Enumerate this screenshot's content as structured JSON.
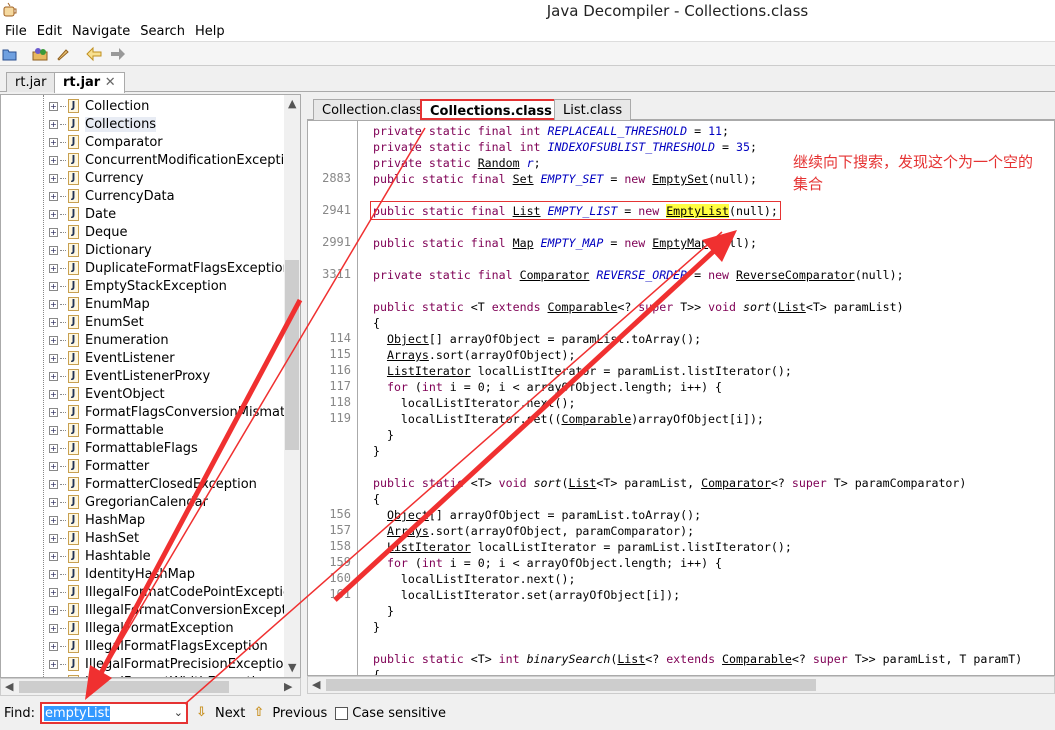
{
  "window": {
    "title": "Java Decompiler - Collections.class"
  },
  "menu": [
    "File",
    "Edit",
    "Navigate",
    "Search",
    "Help"
  ],
  "toolbar": [
    "open-folder-icon",
    "open-type-icon",
    "search-icon",
    "back-arrow-icon",
    "forward-arrow-icon"
  ],
  "jar_tabs": [
    {
      "label": "rt.jar",
      "active": false
    },
    {
      "label": "rt.jar",
      "active": true
    }
  ],
  "tree": {
    "items": [
      "Collection",
      "Collections",
      "Comparator",
      "ConcurrentModificationException",
      "Currency",
      "CurrencyData",
      "Date",
      "Deque",
      "Dictionary",
      "DuplicateFormatFlagsException",
      "EmptyStackException",
      "EnumMap",
      "EnumSet",
      "Enumeration",
      "EventListener",
      "EventListenerProxy",
      "EventObject",
      "FormatFlagsConversionMismatchE",
      "Formattable",
      "FormattableFlags",
      "Formatter",
      "FormatterClosedException",
      "GregorianCalendar",
      "HashMap",
      "HashSet",
      "Hashtable",
      "IdentityHashMap",
      "IllegalFormatCodePointException",
      "IllegalFormatConversionException",
      "IllegalFormatException",
      "IllegalFormatFlagsException",
      "IllegalFormatPrecisionException",
      "IllegalFormatWidthException"
    ],
    "selected": "Collections"
  },
  "file_tabs": [
    {
      "label": "Collection.class",
      "active": false
    },
    {
      "label": "Collections.class",
      "active": true
    },
    {
      "label": "List.class",
      "active": false
    }
  ],
  "code": [
    {
      "ln": "",
      "t": [
        [
          "k",
          "private static final int "
        ],
        [
          "i",
          "REPLACEALL_THRESHOLD"
        ],
        [
          "p",
          " = "
        ],
        [
          "n",
          "11"
        ],
        [
          "p",
          ";"
        ]
      ]
    },
    {
      "ln": "",
      "t": [
        [
          "k",
          "private static final int "
        ],
        [
          "i",
          "INDEXOFSUBLIST_THRESHOLD"
        ],
        [
          "p",
          " = "
        ],
        [
          "n",
          "35"
        ],
        [
          "p",
          ";"
        ]
      ]
    },
    {
      "ln": "",
      "t": [
        [
          "k",
          "private static "
        ],
        [
          "u",
          "Random"
        ],
        [
          "p",
          " "
        ],
        [
          "i",
          "r"
        ],
        [
          "p",
          ";"
        ]
      ]
    },
    {
      "ln": "2883",
      "t": [
        [
          "k",
          "public static final "
        ],
        [
          "u",
          "Set"
        ],
        [
          "p",
          " "
        ],
        [
          "i",
          "EMPTY_SET"
        ],
        [
          "p",
          " = "
        ],
        [
          "k",
          "new "
        ],
        [
          "u",
          "EmptySet"
        ],
        [
          "p",
          "(null);"
        ]
      ]
    },
    {
      "ln": "",
      "t": []
    },
    {
      "ln": "2941",
      "t": [
        [
          "k",
          "public static final "
        ],
        [
          "u",
          "List"
        ],
        [
          "p",
          " "
        ],
        [
          "i",
          "EMPTY_LIST"
        ],
        [
          "p",
          " = "
        ],
        [
          "k",
          "new "
        ],
        [
          "h",
          "EmptyList"
        ],
        [
          "p",
          "(null);"
        ]
      ]
    },
    {
      "ln": "",
      "t": []
    },
    {
      "ln": "2991",
      "t": [
        [
          "k",
          "public static final "
        ],
        [
          "u",
          "Map"
        ],
        [
          "p",
          " "
        ],
        [
          "i",
          "EMPTY_MAP"
        ],
        [
          "p",
          " = "
        ],
        [
          "k",
          "new "
        ],
        [
          "u",
          "EmptyMap"
        ],
        [
          "p",
          "(null);"
        ]
      ]
    },
    {
      "ln": "",
      "t": []
    },
    {
      "ln": "3311",
      "t": [
        [
          "k",
          "private static final "
        ],
        [
          "u",
          "Comparator"
        ],
        [
          "p",
          " "
        ],
        [
          "i",
          "REVERSE_ORDER"
        ],
        [
          "p",
          " = "
        ],
        [
          "k",
          "new "
        ],
        [
          "u",
          "ReverseComparator"
        ],
        [
          "p",
          "(null);"
        ]
      ]
    },
    {
      "ln": "",
      "t": []
    },
    {
      "ln": "",
      "t": [
        [
          "k",
          "public static "
        ],
        [
          "p",
          "<T "
        ],
        [
          "k",
          "extends "
        ],
        [
          "u",
          "Comparable"
        ],
        [
          "p",
          "<? "
        ],
        [
          "k",
          "super "
        ],
        [
          "p",
          "T>> "
        ],
        [
          "k",
          "void "
        ],
        [
          "m",
          "sort"
        ],
        [
          "p",
          "("
        ],
        [
          "u",
          "List"
        ],
        [
          "p",
          "<T> paramList)"
        ]
      ]
    },
    {
      "ln": "",
      "t": [
        [
          "p",
          "{"
        ]
      ]
    },
    {
      "ln": "114",
      "t": [
        [
          "p",
          "  "
        ],
        [
          "u",
          "Object"
        ],
        [
          "p",
          "[] arrayOfObject = paramList.toArray();"
        ]
      ]
    },
    {
      "ln": "115",
      "t": [
        [
          "p",
          "  "
        ],
        [
          "u",
          "Arrays"
        ],
        [
          "p",
          ".sort(arrayOfObject);"
        ]
      ]
    },
    {
      "ln": "116",
      "t": [
        [
          "p",
          "  "
        ],
        [
          "u",
          "ListIterator"
        ],
        [
          "p",
          " localListIterator = paramList.listIterator();"
        ]
      ]
    },
    {
      "ln": "117",
      "t": [
        [
          "p",
          "  "
        ],
        [
          "k",
          "for "
        ],
        [
          "p",
          "("
        ],
        [
          "k",
          "int "
        ],
        [
          "p",
          "i = 0; i < arrayOfObject.length; i++) {"
        ]
      ]
    },
    {
      "ln": "118",
      "t": [
        [
          "p",
          "    localListIterator.next();"
        ]
      ]
    },
    {
      "ln": "119",
      "t": [
        [
          "p",
          "    localListIterator.set(("
        ],
        [
          "u",
          "Comparable"
        ],
        [
          "p",
          ")arrayOfObject[i]);"
        ]
      ]
    },
    {
      "ln": "",
      "t": [
        [
          "p",
          "  }"
        ]
      ]
    },
    {
      "ln": "",
      "t": [
        [
          "p",
          "}"
        ]
      ]
    },
    {
      "ln": "",
      "t": []
    },
    {
      "ln": "",
      "t": [
        [
          "k",
          "public static "
        ],
        [
          "p",
          "<T> "
        ],
        [
          "k",
          "void "
        ],
        [
          "m",
          "sort"
        ],
        [
          "p",
          "("
        ],
        [
          "u",
          "List"
        ],
        [
          "p",
          "<T> paramList, "
        ],
        [
          "u",
          "Comparator"
        ],
        [
          "p",
          "<? "
        ],
        [
          "k",
          "super "
        ],
        [
          "p",
          "T> paramComparator)"
        ]
      ]
    },
    {
      "ln": "",
      "t": [
        [
          "p",
          "{"
        ]
      ]
    },
    {
      "ln": "156",
      "t": [
        [
          "p",
          "  "
        ],
        [
          "u",
          "Object"
        ],
        [
          "p",
          "[] arrayOfObject = paramList.toArray();"
        ]
      ]
    },
    {
      "ln": "157",
      "t": [
        [
          "p",
          "  "
        ],
        [
          "u",
          "Arrays"
        ],
        [
          "p",
          ".sort(arrayOfObject, paramComparator);"
        ]
      ]
    },
    {
      "ln": "158",
      "t": [
        [
          "p",
          "  "
        ],
        [
          "u",
          "ListIterator"
        ],
        [
          "p",
          " localListIterator = paramList.listIterator();"
        ]
      ]
    },
    {
      "ln": "159",
      "t": [
        [
          "p",
          "  "
        ],
        [
          "k",
          "for "
        ],
        [
          "p",
          "("
        ],
        [
          "k",
          "int "
        ],
        [
          "p",
          "i = 0; i < arrayOfObject.length; i++) {"
        ]
      ]
    },
    {
      "ln": "160",
      "t": [
        [
          "p",
          "    localListIterator.next();"
        ]
      ]
    },
    {
      "ln": "161",
      "t": [
        [
          "p",
          "    localListIterator.set(arrayOfObject[i]);"
        ]
      ]
    },
    {
      "ln": "",
      "t": [
        [
          "p",
          "  }"
        ]
      ]
    },
    {
      "ln": "",
      "t": [
        [
          "p",
          "}"
        ]
      ]
    },
    {
      "ln": "",
      "t": []
    },
    {
      "ln": "",
      "t": [
        [
          "k",
          "public static "
        ],
        [
          "p",
          "<T> "
        ],
        [
          "k",
          "int "
        ],
        [
          "m",
          "binarySearch"
        ],
        [
          "p",
          "("
        ],
        [
          "u",
          "List"
        ],
        [
          "p",
          "<? "
        ],
        [
          "k",
          "extends "
        ],
        [
          "u",
          "Comparable"
        ],
        [
          "p",
          "<? "
        ],
        [
          "k",
          "super "
        ],
        [
          "p",
          "T>> paramList, T paramT)"
        ]
      ]
    },
    {
      "ln": "",
      "t": [
        [
          "p",
          "{"
        ]
      ]
    }
  ],
  "annotation": {
    "text": "继续向下搜索，发现这个为一个空的集合",
    "color": "#e53333"
  },
  "find": {
    "label": "Find:",
    "value": "emptyList",
    "next": "Next",
    "previous": "Previous",
    "case_sensitive": "Case sensitive",
    "case_checked": false
  },
  "colors": {
    "keyword": "#7f0055",
    "field": "#0000c0",
    "highlight": "#ffff40",
    "annotation": "#e53333"
  }
}
